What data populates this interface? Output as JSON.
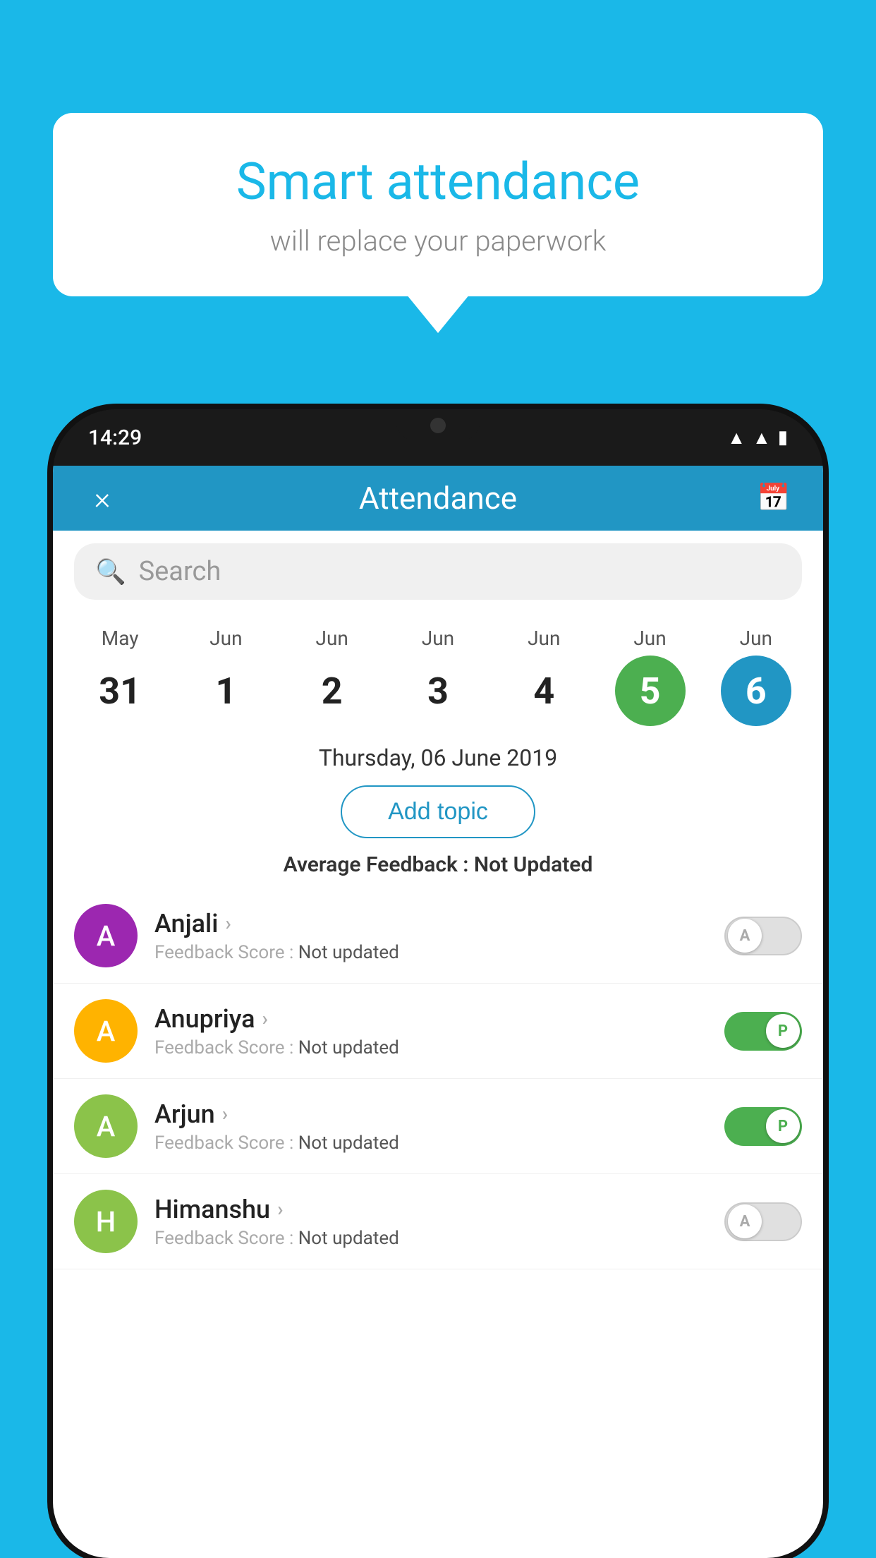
{
  "background_color": "#1ab8e8",
  "speech_bubble": {
    "title": "Smart attendance",
    "subtitle": "will replace your paperwork"
  },
  "status_bar": {
    "time": "14:29"
  },
  "app_header": {
    "title": "Attendance",
    "close_label": "×"
  },
  "search": {
    "placeholder": "Search"
  },
  "calendar": {
    "days": [
      {
        "month": "May",
        "date": "31",
        "style": "normal"
      },
      {
        "month": "Jun",
        "date": "1",
        "style": "normal"
      },
      {
        "month": "Jun",
        "date": "2",
        "style": "normal"
      },
      {
        "month": "Jun",
        "date": "3",
        "style": "normal"
      },
      {
        "month": "Jun",
        "date": "4",
        "style": "normal"
      },
      {
        "month": "Jun",
        "date": "5",
        "style": "green"
      },
      {
        "month": "Jun",
        "date": "6",
        "style": "blue"
      }
    ]
  },
  "selected_date": "Thursday, 06 June 2019",
  "add_topic_label": "Add topic",
  "avg_feedback_label": "Average Feedback :",
  "avg_feedback_value": "Not Updated",
  "students": [
    {
      "name": "Anjali",
      "avatar_letter": "A",
      "avatar_color": "#9c27b0",
      "feedback_label": "Feedback Score :",
      "feedback_value": "Not updated",
      "attendance": "absent",
      "toggle_label": "A"
    },
    {
      "name": "Anupriya",
      "avatar_letter": "A",
      "avatar_color": "#ffb300",
      "feedback_label": "Feedback Score :",
      "feedback_value": "Not updated",
      "attendance": "present",
      "toggle_label": "P"
    },
    {
      "name": "Arjun",
      "avatar_letter": "A",
      "avatar_color": "#8bc34a",
      "feedback_label": "Feedback Score :",
      "feedback_value": "Not updated",
      "attendance": "present",
      "toggle_label": "P"
    },
    {
      "name": "Himanshu",
      "avatar_letter": "H",
      "avatar_color": "#8bc34a",
      "feedback_label": "Feedback Score :",
      "feedback_value": "Not updated",
      "attendance": "absent",
      "toggle_label": "A"
    }
  ]
}
